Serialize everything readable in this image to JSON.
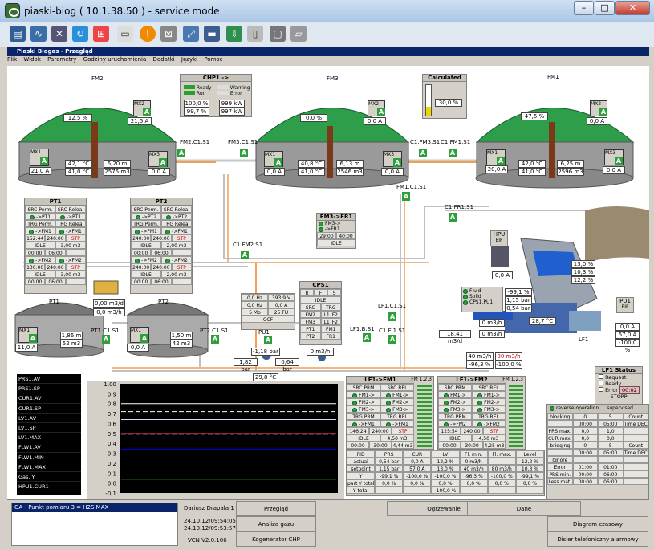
{
  "window": {
    "title": "piaski-biog ( 10.1.38.50 ) - service mode"
  },
  "inner": {
    "title": "Piaski Biogas - Przegląd"
  },
  "menu": [
    "Plik",
    "Widok",
    "Parametry",
    "Godziny uruchomienia",
    "Dodatki",
    "Języki",
    "Pomoc"
  ],
  "fermenters": {
    "fm2": {
      "name": "FM2",
      "level": "12,5 %",
      "mx2_label": "MX2",
      "mx2_val": "21,5 A",
      "mx1_label": "MX1",
      "mx1_val": "21,0 A",
      "temp1": "42,1 °C",
      "temp2": "41,0 °C",
      "level_m": "6,20 m",
      "vol": "2575 m3",
      "mx3_label": "MX3",
      "mx3_val": "0,0 A"
    },
    "fm3": {
      "name": "FM3",
      "level": "0,0 %",
      "mx2_label": "MX2",
      "mx2_val": "0,0 A",
      "mx1_label": "MX1",
      "mx1_val": "0,0 A",
      "temp1": "40,8 °C",
      "temp2": "41,0 °C",
      "level_m": "6,13 m",
      "vol": "2546 m3",
      "mx3_label": "MX3",
      "mx3_val": "0,0 A"
    },
    "fm1": {
      "name": "FM1",
      "level": "47,5 %",
      "mx2_label": "MX2",
      "mx2_val": "0,0 A",
      "mx1_label": "MX1",
      "mx1_val": "20,0 A",
      "temp1": "42,0 °C",
      "temp2": "41,0 °C",
      "level_m": "6,25 m",
      "vol": "2596 m3",
      "mx3_label": "MX3",
      "mx3_val": "0,0 A"
    }
  },
  "chp": {
    "title": "CHP1 ->",
    "ready": "Ready",
    "run": "Run",
    "warning": "Warning",
    "error": "Error",
    "v1": "100,0 %",
    "v2": "99,7 %",
    "v3": "999 kW",
    "v4": "997 kW"
  },
  "calculated": {
    "title": "Calculated",
    "val": "30,0 %",
    "fill": 0.3
  },
  "valves": {
    "fm2c1s1": "FM2.C1.S1",
    "fm3c1s1": "FM3.C1.S1",
    "c1fm3s1": "C1.FM3.S1",
    "c1fm1s1": "C1.FM1.S1",
    "fm1c1s1": "FM1.C1.S1",
    "c1fr1s1": "C1.FR1.S1",
    "c1fm2s1": "C1.FM2.S1",
    "pt1c1s1": "PT1.C1.S1",
    "pt2c1s1": "PT2.C1.S1",
    "lf1c1s1": "LF1.C1.S1",
    "lf1bs1": "LF1.B.S1",
    "c1fi1s1": "C1.FI1.S1"
  },
  "pt1": {
    "title": "PT1",
    "h1": "SRC Perm.",
    "h2": "SRC Relea.",
    "src1": "->PT1",
    "src2": "->PT1",
    "trg1": "TRG Perm.",
    "trg2": "TRG Relea.",
    "fm1": "->FM1",
    "fm1b": "->FM1",
    "t1": "152:44",
    "v1": "240:00",
    "stp": "STP",
    "idle": "IDLE",
    "m1": "3,00 m3",
    "t2": "00:00",
    "v2": "06:00",
    "fm2": "->FM2",
    "fm2b": "->FM2",
    "t3": "130:00",
    "v3": "240:00",
    "stp2": "STP",
    "idle2": "IDLE",
    "m2": "3,00 m3",
    "t4": "00:00",
    "v4": "06:00"
  },
  "pt2": {
    "title": "PT2",
    "h1": "SRC Perm.",
    "h2": "SRC Relea.",
    "src1": "->PT2",
    "src2": "->PT2",
    "trg1": "TRG Perm.",
    "trg2": "TRG Relea.",
    "fm1": "->FM1",
    "fm1b": "->FM1",
    "t1": "240:00",
    "v1": "240:00",
    "stp": "STP",
    "idle": "IDLE",
    "m1": "2,00 m3",
    "t2": "00:00",
    "v2": "06:00",
    "fm2": "->FM2",
    "fm2b": "->FM2",
    "t3": "240:00",
    "v3": "240:00",
    "stp2": "STP",
    "idle2": "IDLE",
    "m2": "2,00 m3",
    "t4": "00:00",
    "v4": "06:00"
  },
  "fm3fr1": {
    "title": "FM3->FR1",
    "a": "FM3->",
    "b": "->FR1",
    "t": "29:00",
    "v": "40:00",
    "idle": "IDLE"
  },
  "flows": {
    "pt_flow1": "0,00 m3/d",
    "pt_flow2": "0,0 m3/h"
  },
  "pt1tank": {
    "name": "PT1",
    "mx1": "MX1",
    "mx1_val": "11,0 A",
    "level": "1,86 m",
    "vol": "52 m3"
  },
  "pt2tank": {
    "name": "PT2",
    "mx1": "MX1",
    "mx1_val": "0,0 A",
    "level": "1,50 m",
    "vol": "42 m3"
  },
  "ocf": {
    "hz1": "0,0 Hz",
    "v1": "393,9 V",
    "hz2": "0,0 Hz",
    "v2": "0,0 A",
    "fu_a": "5 Mo",
    "fu_b": "25 FU",
    "name": "OCF"
  },
  "pu1": {
    "name": "PU1",
    "bar": "-1,18 bar",
    "p1": "1,82 bar",
    "p2": "0,64 bar",
    "temp": "29,8 °C"
  },
  "cps1": {
    "title": "CPS1",
    "idle": "IDLE",
    "src": "SRC",
    "trg": "TRG",
    "fm2": "FM2",
    "fm3": "FM3",
    "lf1": "L1_F2",
    "lf2": "L1_F2",
    "pt1": "PT1",
    "pt2": "PT2",
    "pt3": "FM1",
    "fm1": "FR1",
    "flow": "0 m3/h"
  },
  "hpu": {
    "name": "HPU",
    "elf": "EIF",
    "val": "0,0 A"
  },
  "feeder": {
    "v1": "13,0 %",
    "v2": "10,3 %",
    "v3": "12,2 %"
  },
  "solid": {
    "fluid": "Fluid",
    "solid": "Solid",
    "cps1pu1": "CPS1.PU1",
    "v1": "-99,1 %",
    "v2": "1,15 bar",
    "v3": "0,54 bar"
  },
  "lf1area": {
    "temp": "28,7 °C",
    "flow1": "0 m3/h",
    "flow2": "18,41 m3/d",
    "flow3": "0 m3/h",
    "flow4": "40 m3/h",
    "flow5": "80 m3/h",
    "p1": "-96,3 %",
    "p2": "-100,0 %",
    "name": "LF1"
  },
  "pu1right": {
    "name": "PU1",
    "elf": "EIF",
    "v1": "0,0 A",
    "v2": "57,0 A",
    "v3": "-100,0 %"
  },
  "lf1fm1": {
    "title": "LF1->FM1",
    "fm": "FM 1,2,3",
    "h1": "SRC PRM",
    "h2": "SRC REL",
    "r1": "FM1->",
    "r2": "FM2->",
    "r3": "FM3->",
    "trg": "TRG PRM",
    "trg2": "TRG REL",
    "fm1": "->FM1",
    "fm1b": "->FM1",
    "t": "146:24",
    "v": "240:00",
    "stp": "STP",
    "idle": "IDLE",
    "m": "4,50 m3",
    "t2": "00:00",
    "v2": "30:00",
    "m2": "4,44 m3"
  },
  "lf1fm2": {
    "title": "LF1->FM2",
    "fm": "FM 1,2,3",
    "h1": "SRC PRM",
    "h2": "SRC REL",
    "r1": "FM1->",
    "r2": "FM2->",
    "r3": "FM3->",
    "trg": "TRG PRM",
    "trg2": "TRG REL",
    "fm1": "->FM2",
    "fm1b": "->FM2",
    "t": "125:54",
    "v": "240:00",
    "stp": "STP",
    "idle": "IDLE",
    "m": "4,50 m3",
    "t2": "00:00",
    "v2": "30:00",
    "m2": "4,25 m3"
  },
  "lf1status": {
    "title": "LF1 Status",
    "request": "Request",
    "ready": "Ready",
    "error": "Error",
    "err_val": "00:02",
    "stopp": "STOPP"
  },
  "reverse": {
    "label": "reverse operation",
    "sup": "supervised",
    "blocking": "blocking",
    "b1": "0",
    "b2": "5",
    "count": "Count",
    "bt1": "00:00",
    "bt2": "05:00",
    "timedec": "Time DEC",
    "prs": "PRS max.",
    "p1": "0,0",
    "p2": "1,0",
    "cur": "CUR max.",
    "c1": "0,0",
    "c2": "0,0",
    "bridging": "bridging",
    "br1": "0",
    "br2": "5",
    "brt1": "00:00",
    "brt2": "05:00",
    "ignore": "Ignore",
    "err": "Error",
    "e1": "01:00",
    "e2": "01:00",
    "prsmin": "PRS min.",
    "pm1": "00:00",
    "pm2": "06:00",
    "less": "Less mat.",
    "l1": "00:00",
    "l2": "06:00"
  },
  "pid": {
    "headers": [
      "PID",
      "PRS",
      "CUR",
      "LV",
      "Fl. min.",
      "Fl. max.",
      "Level"
    ],
    "actual": [
      "actual",
      "0,54 bar",
      "0,0 A",
      "12,2 %",
      "0 m3/h",
      "",
      "12,2 %"
    ],
    "setpoint": [
      "setpoint",
      "1,15 bar",
      "57,0 A",
      "13,0 %",
      "40 m3/h",
      "80 m3/h",
      "10,3 %"
    ],
    "y": [
      "Y",
      "-99,1 %",
      "-100,0 %",
      "-100,0 %",
      "-96,3 %",
      "-100,0 %",
      "-99,1 %"
    ],
    "ytotal": [
      "part Y total",
      "0,0 %",
      "0,0 %",
      "0,0 %",
      "0,0 %",
      "0,0 %",
      "0,0 %"
    ],
    "ytot": [
      "Y total",
      "",
      "",
      "-100,0 %",
      "",
      "",
      ""
    ]
  },
  "legend": [
    "PRS1.AV",
    "PRS1.SP",
    "CUR1.AV",
    "CUR1.SP",
    "LV1.AV",
    "LV1.SP",
    "LV1.MAX",
    "FLW1.AV",
    "FLW1.MIN",
    "FLW1.MAX",
    "Gas. Y",
    "HPU1.CUR1"
  ],
  "chart_data": {
    "type": "line",
    "yticks": [
      "1,00",
      "0,9",
      "0,8",
      "0,7",
      "0,6",
      "0,5",
      "0,4",
      "0,3",
      "0,2",
      "0,1",
      "0,0",
      "-0,1"
    ],
    "ylim": [
      -0.1,
      1.0
    ],
    "series": [
      {
        "name": "PRS1.AV",
        "color": "#ffffff",
        "values": [
          0.8,
          0.8
        ]
      },
      {
        "name": "PRS1.SP",
        "color": "#ffffff",
        "values": [
          0.72,
          0.72
        ]
      },
      {
        "name": "CUR1.AV",
        "color": "#d6d6ff",
        "values": [
          0.64,
          0.64
        ]
      },
      {
        "name": "LV1.AV",
        "color": "#ff3b3b",
        "values": [
          0.5,
          0.5
        ]
      },
      {
        "name": "LV1.SP",
        "color": "#5b5bff",
        "values": [
          0.49,
          0.49
        ]
      },
      {
        "name": "FLW1.AV",
        "color": "#0000ff",
        "values": [
          0.34,
          0.34
        ]
      },
      {
        "name": "Gas. Y",
        "color": "#28d028",
        "values": [
          0.04,
          0.04
        ]
      }
    ]
  },
  "status": {
    "alarm": "GA - Punkt pomiaru 3 = H2S MAX",
    "user": "Dariusz Drapala:1",
    "t1": "24.10.12/09:54:05",
    "t2": "24.10.12/09:53:57",
    "ver": "VCN V2.0.106",
    "b_przeglad": "Przegląd",
    "b_gaz": "Analiza gazu",
    "b_kog": "Kogenerator CHP",
    "b_grz": "Ogrzewanie",
    "b_dane": "Dane",
    "b_diag": "Diagram czasowy",
    "b_disl": "Disler telefoniczny alarmowy"
  },
  "colors": {
    "green_roof": "#2e9e4a",
    "pipe_grey": "#c0c0c0",
    "pipe_orange": "#f0a050"
  }
}
